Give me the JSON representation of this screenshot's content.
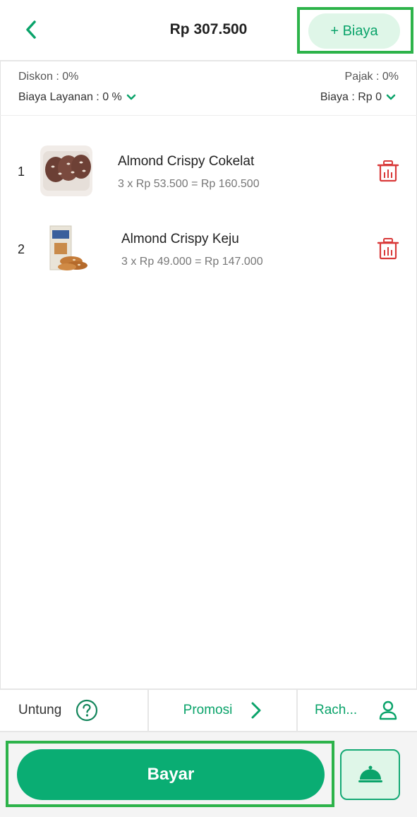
{
  "header": {
    "back_icon": "chevron-left-icon",
    "total": "Rp 307.500",
    "add_fee_label": "+ Biaya"
  },
  "settings": {
    "diskon": "Diskon : 0%",
    "pajak": "Pajak  : 0%",
    "biaya_layanan": "Biaya Layanan : 0 %",
    "biaya": "Biaya : Rp 0"
  },
  "items": [
    {
      "number": "1",
      "name": "Almond Crispy Cokelat",
      "price_line": "3 x Rp 53.500 = Rp 160.500",
      "thumbnail_icon": "chocolate-crisps-image"
    },
    {
      "number": "2",
      "name": "Almond Crispy Keju",
      "price_line": "3 x Rp 49.000 = Rp 147.000",
      "thumbnail_icon": "cheese-crisps-image"
    }
  ],
  "bottom_bar": {
    "untung_label": "Untung",
    "promosi_label": "Promosi",
    "customer_label": "Rach..."
  },
  "footer": {
    "pay_label": "Bayar",
    "order_icon": "food-cloche-icon"
  },
  "colors": {
    "accent": "#0aad73",
    "accent_light": "#dff6e8",
    "delete": "#d93a3a",
    "highlight": "#2db34a"
  }
}
